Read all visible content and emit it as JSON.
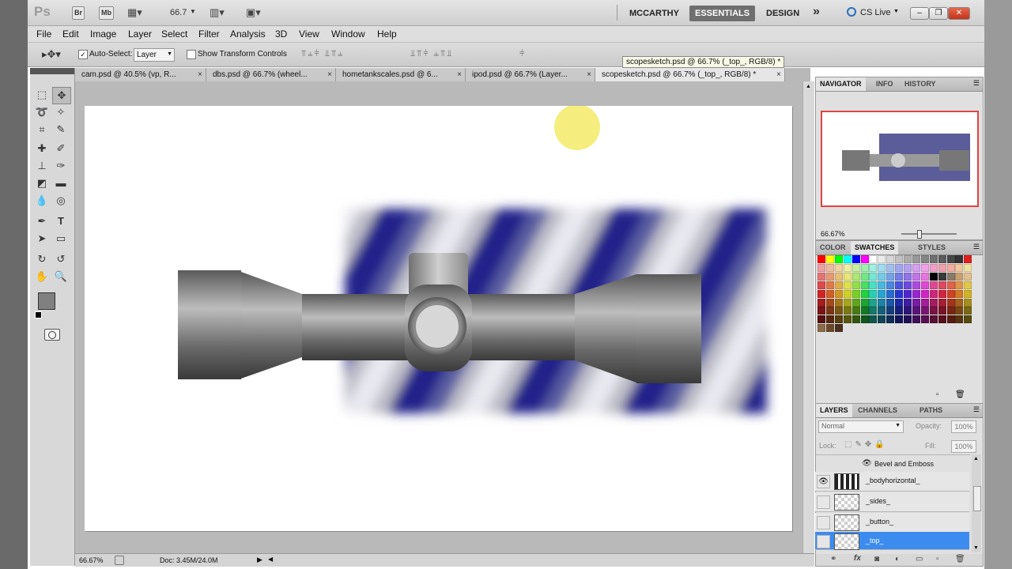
{
  "app": {
    "logo": "Ps",
    "bridge_btn": "Br",
    "minibridge_btn": "Mb",
    "zoom_value": "66.7",
    "workspaces": [
      "MCCARTHY",
      "ESSENTIALS",
      "DESIGN"
    ],
    "more_glyph": "»",
    "cslive": "CS Live",
    "window_buttons": [
      "–",
      "❐",
      "✕"
    ]
  },
  "menu": [
    "File",
    "Edit",
    "Image",
    "Layer",
    "Select",
    "Filter",
    "Analysis",
    "3D",
    "View",
    "Window",
    "Help"
  ],
  "options": {
    "auto_select_label": "Auto-Select:",
    "auto_select_value": "Layer",
    "transform_label": "Show Transform Controls"
  },
  "tabs": [
    {
      "label": "cam.psd @ 40.5% (vp, R...",
      "close": "×"
    },
    {
      "label": "dbs.psd @ 66.7% (wheel...",
      "close": "×"
    },
    {
      "label": "hometankscales.psd @ 6...",
      "close": "×"
    },
    {
      "label": "ipod.psd @ 66.7% (Layer...",
      "close": "×"
    },
    {
      "label": "scopesketch.psd @ 66.7% (_top_, RGB/8) *",
      "close": "×"
    }
  ],
  "tooltip": "scopesketch.psd @ 66.7% (_top_, RGB/8) *",
  "status": {
    "zoom": "66.67%",
    "doc": "Doc: 3.45M/24.0M"
  },
  "navigator": {
    "tabs": [
      "NAVIGATOR",
      "INFO",
      "HISTORY"
    ],
    "zoom": "66.67%"
  },
  "swatches_panel": {
    "tabs": [
      "COLOR",
      "SWATCHES",
      "STYLES"
    ]
  },
  "layers_panel": {
    "tabs": [
      "LAYERS",
      "CHANNELS",
      "PATHS"
    ],
    "blend_mode": "Normal",
    "opacity_label": "Opacity:",
    "opacity": "100%",
    "lock_label": "Lock:",
    "fill_label": "Fill:",
    "fill": "100%",
    "effect": "Bevel and Emboss",
    "layers": [
      {
        "name": "_bodyhorizontal_",
        "visible": true
      },
      {
        "name": "_sides_",
        "visible": false
      },
      {
        "name": "_button_",
        "visible": false
      },
      {
        "name": "_top_",
        "visible": false
      }
    ]
  },
  "colors": {
    "accent": "#3c8cf0",
    "foreground": "#808080",
    "background": "#b52020",
    "highlight": "#f4ec70"
  }
}
